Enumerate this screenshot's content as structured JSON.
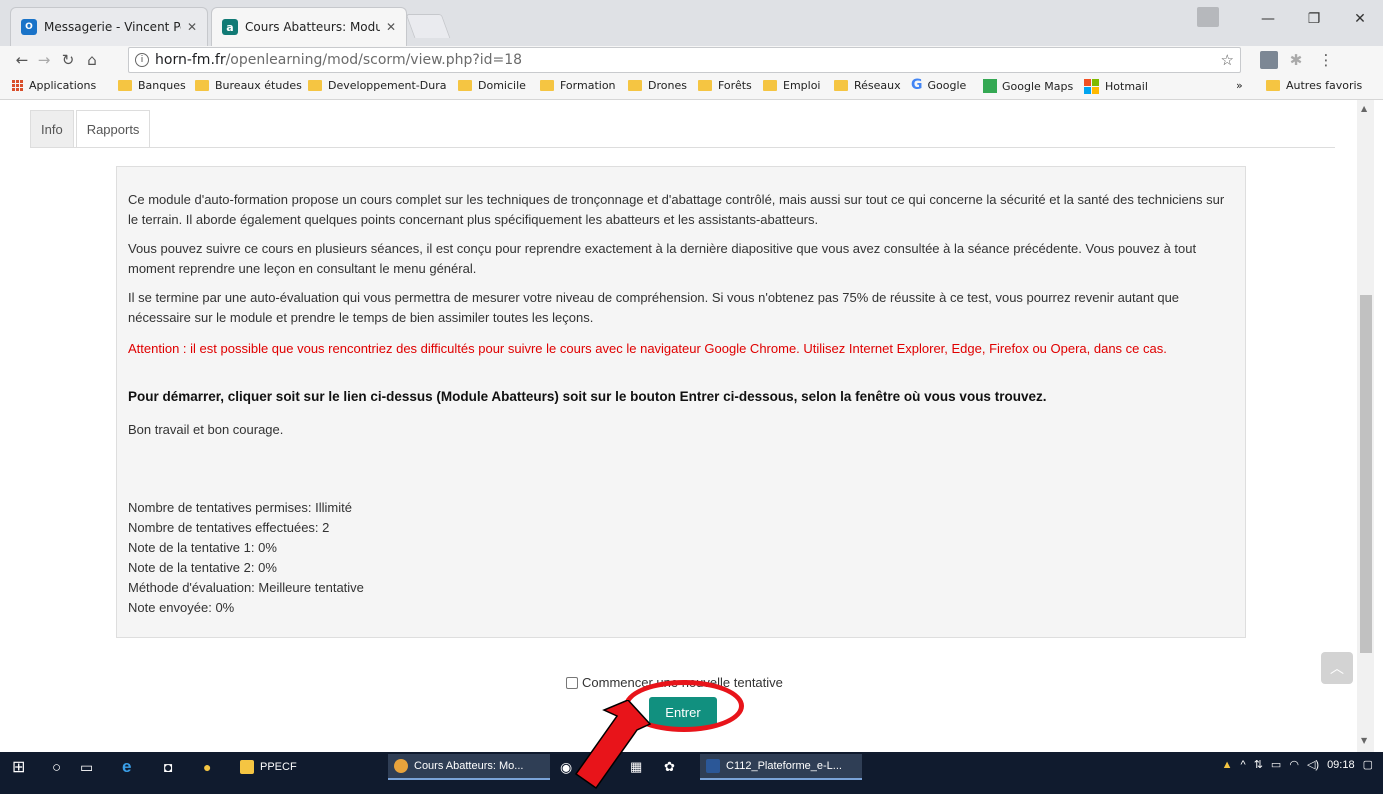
{
  "browser": {
    "tabs": [
      {
        "title": "Messagerie - Vincent Pel",
        "favicon": "outlook-icon"
      },
      {
        "title": "Cours Abatteurs: Module",
        "favicon": "moodle-icon"
      }
    ],
    "address": {
      "host": "horn-fm.fr",
      "path": "/openlearning/mod/scorm/view.php?id=18"
    },
    "bookmarks": [
      "Applications",
      "Banques",
      "Bureaux études",
      "Developpement-Dura",
      "Domicile",
      "Formation",
      "Drones",
      "Forêts",
      "Emploi",
      "Réseaux",
      "Google",
      "Google Maps",
      "Hotmail"
    ],
    "bookmarks_more": "»",
    "other_bookmarks": "Autres favoris"
  },
  "page": {
    "tabs": [
      "Info",
      "Rapports"
    ],
    "paragraphs": [
      "Ce module d'auto-formation propose un cours complet sur les techniques de tronçonnage et d'abattage contrôlé, mais aussi sur tout ce qui concerne la sécurité et la santé des techniciens sur le terrain. Il aborde également quelques points concernant plus spécifiquement les abatteurs et les assistants-abatteurs.",
      "Vous pouvez suivre ce cours en plusieurs séances, il est conçu pour reprendre exactement à la dernière diapositive que vous avez consultée à la séance précédente. Vous pouvez à tout moment reprendre une leçon en consultant le menu général.",
      "Il se termine par une auto-évaluation qui vous permettra de mesurer votre niveau de compréhension. Si vous n'obtenez pas 75% de réussite à ce test, vous pourrez revenir autant que nécessaire sur le module et prendre le temps de bien assimiler toutes les leçons.",
      "Attention : il est possible que vous rencontriez des difficultés pour suivre le cours avec le navigateur Google Chrome. Utilisez Internet Explorer, Edge, Firefox ou Opera, dans ce cas.",
      "Pour démarrer, cliquer soit sur le lien ci-dessus (Module Abatteurs) soit sur le bouton Entrer ci-dessous, selon la fenêtre où vous vous trouvez.",
      "Bon travail et bon courage."
    ],
    "stats": [
      "Nombre de tentatives permises: Illimité",
      "Nombre de tentatives effectuées: 2",
      "Note de la tentative 1: 0%",
      "Note de la tentative 2: 0%",
      "Méthode d'évaluation: Meilleure tentative",
      "Note envoyée: 0%"
    ],
    "checkbox_label": "Commencer une nouvelle tentative",
    "enter_button": "Entrer",
    "colors": {
      "enter": "#11907f",
      "warning": "#e00000",
      "highlight": "#e8141a"
    }
  },
  "taskbar": {
    "apps": [
      "PPECF",
      "Cours Abatteurs: Mo...",
      "C112_Plateforme_e-L..."
    ],
    "clock": "09:18"
  }
}
